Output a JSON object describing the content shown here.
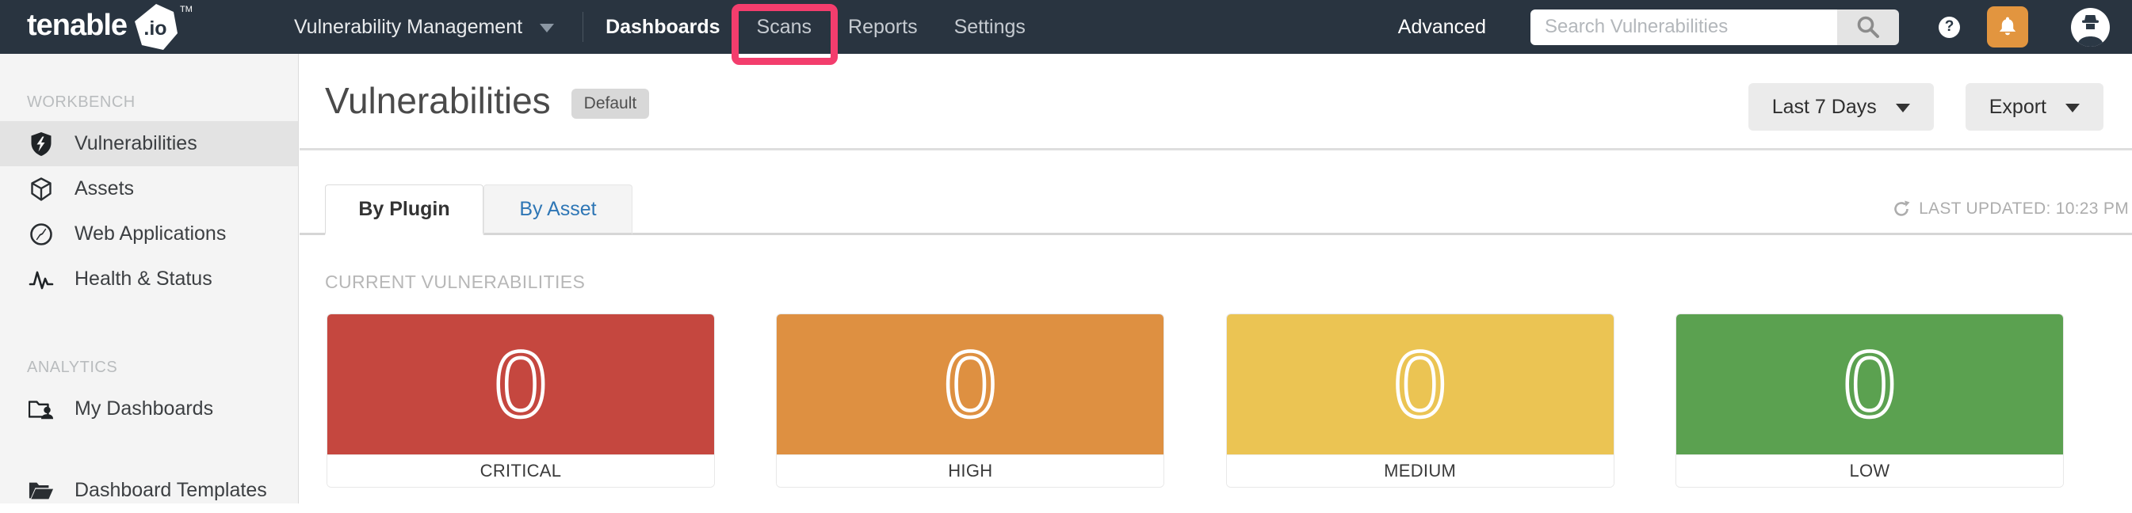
{
  "navbar": {
    "brand": "tenable",
    "brand_suffix": ".io",
    "brand_tm": "TM",
    "product_switcher": "Vulnerability Management",
    "links": [
      {
        "label": "Dashboards",
        "active": true
      },
      {
        "label": "Scans",
        "annotated": true
      },
      {
        "label": "Reports",
        "active": false
      },
      {
        "label": "Settings",
        "active": false
      }
    ],
    "advanced_label": "Advanced",
    "search_placeholder": "Search Vulnerabilities",
    "help_glyph": "?",
    "colors": {
      "background": "#293440",
      "bell": "#E2953F",
      "annotation": "#F33D6D"
    }
  },
  "sidebar": {
    "sections": [
      {
        "title": "WORKBENCH",
        "items": [
          {
            "label": "Vulnerabilities",
            "icon": "shield-bolt-icon",
            "selected": true
          },
          {
            "label": "Assets",
            "icon": "cube-icon",
            "selected": false
          },
          {
            "label": "Web Applications",
            "icon": "web-app-icon",
            "selected": false
          },
          {
            "label": "Health & Status",
            "icon": "pulse-icon",
            "selected": false
          }
        ]
      },
      {
        "title": "ANALYTICS",
        "items": [
          {
            "label": "My Dashboards",
            "icon": "folder-user-icon",
            "selected": false
          },
          {
            "label": "Dashboard Templates",
            "icon": "folder-open-icon",
            "selected": false
          }
        ]
      }
    ]
  },
  "main": {
    "title": "Vulnerabilities",
    "badge": "Default",
    "date_range_selected": "Last 7 Days",
    "export_label": "Export",
    "tabs": [
      {
        "label": "By Plugin",
        "active": true
      },
      {
        "label": "By Asset",
        "active": false
      }
    ],
    "last_updated": "LAST UPDATED: 10:23 PM",
    "section_label": "CURRENT VULNERABILITIES",
    "cards": [
      {
        "label": "CRITICAL",
        "value": "0",
        "color": "#C5473F"
      },
      {
        "label": "HIGH",
        "value": "0",
        "color": "#DE9041"
      },
      {
        "label": "MEDIUM",
        "value": "0",
        "color": "#EBC453"
      },
      {
        "label": "LOW",
        "value": "0",
        "color": "#5BA150"
      }
    ]
  }
}
